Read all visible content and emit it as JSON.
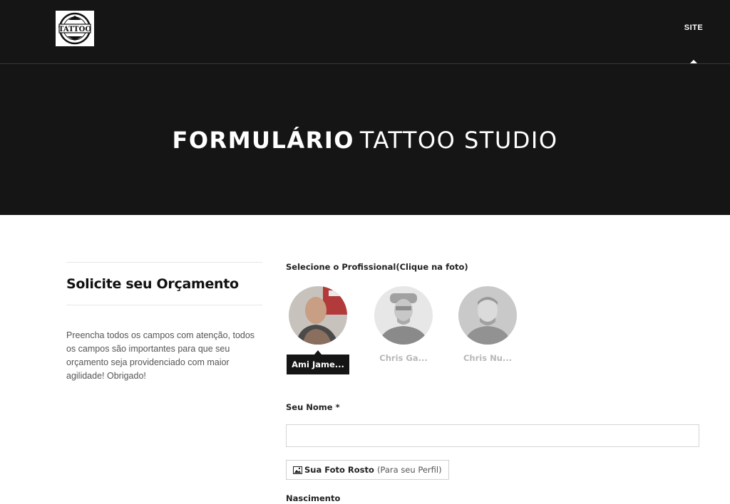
{
  "header": {
    "logo_text": "TATTOO",
    "nav": [
      {
        "label": "SITE",
        "active": true
      }
    ]
  },
  "hero": {
    "title_bold": "FORMULÁRIO",
    "title_light": "TATTOO STUDIO",
    "bg_color": "#151515"
  },
  "sidebar": {
    "title": "Solicite seu Orçamento",
    "description": "Preencha todos os campos com atenção, todos os campos são importantes para que seu orçamento seja providenciado com maior agilidade! Obrigado!"
  },
  "form": {
    "select_professional_label": "Selecione o Profissional(Clique na foto)",
    "professionals": [
      {
        "name": "Ami Jame...",
        "selected": true
      },
      {
        "name": "Chris Ga...",
        "selected": false
      },
      {
        "name": "Chris Nu...",
        "selected": false
      }
    ],
    "name_label": "Seu Nome *",
    "name_value": "",
    "photo_button_label": "Sua Foto Rosto",
    "photo_button_hint": "(Para seu Perfil)",
    "photo_icon": "image-icon",
    "birth_label": "Nascimento"
  }
}
